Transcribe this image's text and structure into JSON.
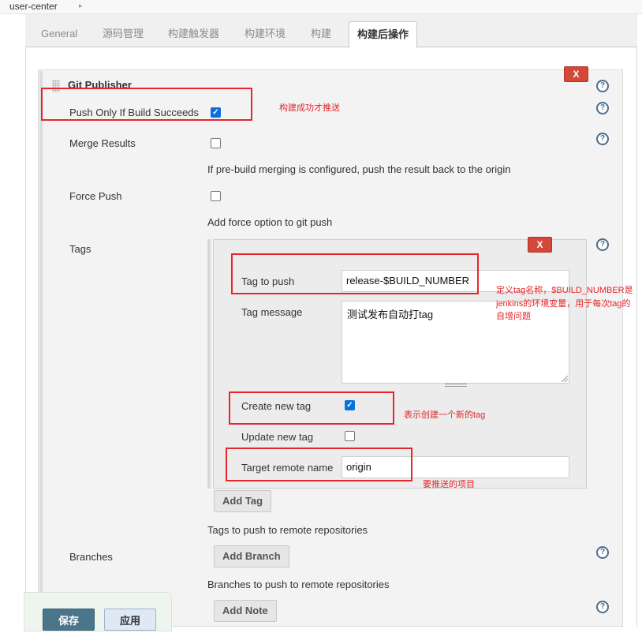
{
  "breadcrumb": {
    "item": "user-center"
  },
  "tabs": [
    "General",
    "源码管理",
    "构建触发器",
    "构建环境",
    "构建",
    "构建后操作"
  ],
  "publisher": {
    "title": "Git Publisher",
    "delete_label": "X",
    "push_only_label": "Push Only If Build Succeeds",
    "push_only_checked": true,
    "merge_label": "Merge Results",
    "merge_checked": false,
    "merge_desc": "If pre-build merging is configured, push the result back to the origin",
    "force_label": "Force Push",
    "force_checked": false,
    "force_desc": "Add force option to git push",
    "tags_label": "Tags",
    "tags_desc": "Tags to push to remote repositories",
    "branches_label": "Branches",
    "branches_desc": "Branches to push to remote repositories",
    "add_branch": "Add Branch",
    "add_note": "Add Note"
  },
  "tag": {
    "delete_label": "X",
    "tag_to_push_label": "Tag to push",
    "tag_to_push_value": "release-$BUILD_NUMBER",
    "tag_message_label": "Tag message",
    "tag_message_value": "测试发布自动打tag",
    "create_new_label": "Create new tag",
    "create_new_checked": true,
    "update_new_label": "Update new tag",
    "update_new_checked": false,
    "target_remote_label": "Target remote name",
    "target_remote_value": "origin",
    "add_tag": "Add Tag"
  },
  "annotations": {
    "push_success": "构建成功才推送",
    "tag_name_line1": "定义tag名称，$BUILD_NUMBER是",
    "tag_name_line2": "jenkins的环境变量，用于每次tag的",
    "tag_name_line3": "自增问题",
    "create_tag": "表示创建一个新的tag",
    "remote": "要推送的项目"
  },
  "footer": {
    "save": "保存",
    "apply": "应用"
  },
  "colors": {
    "annotation": "#e6262d",
    "delete": "#d24939",
    "save": "#4b758b",
    "checkbox": "#0b6fdc"
  },
  "icons": [
    "help-icon",
    "drag-handle-icon",
    "checkmark-icon",
    "breadcrumb-arrow-icon"
  ]
}
